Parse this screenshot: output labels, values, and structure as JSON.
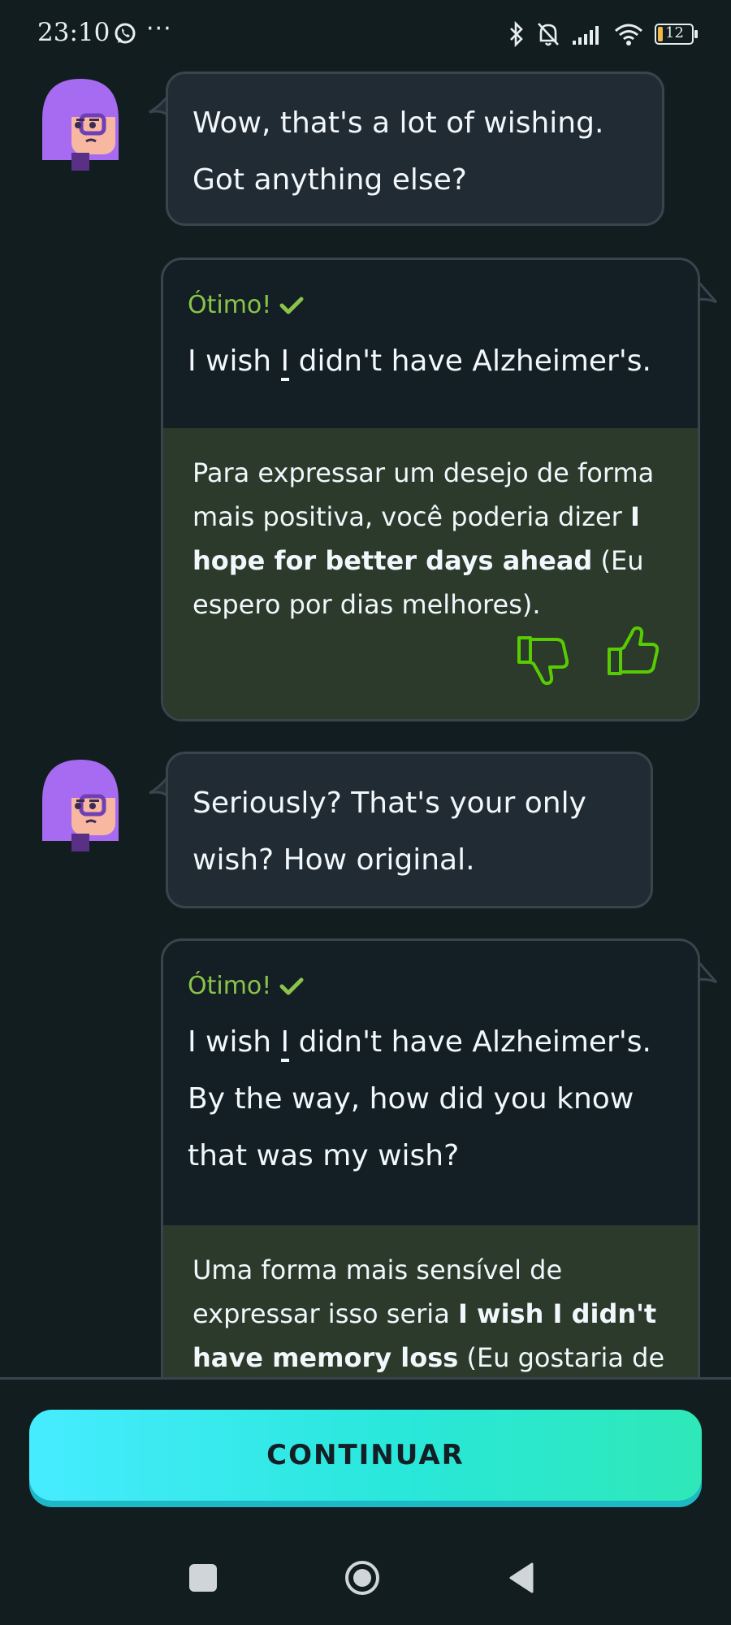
{
  "status_bar": {
    "time": "23:10",
    "more": "···",
    "battery": "12",
    "icons": [
      "whatsapp-icon",
      "bluetooth-icon",
      "bell-off-icon",
      "signal-icon",
      "wifi-icon",
      "battery-icon"
    ]
  },
  "messages": [
    {
      "speaker": "character",
      "text": "Wow, that's a lot of wishing. Got anything else?"
    },
    {
      "speaker": "user",
      "status": "Ótimo!",
      "text_before": "I wish ",
      "text_highlight": "I",
      "text_after": " didn't have Alzheimer's.",
      "tip_before": "Para expressar um desejo de forma mais positiva, você poderia dizer ",
      "tip_bold": "I hope for better days ahead",
      "tip_after": " (Eu espero por dias melhores)."
    },
    {
      "speaker": "character",
      "text": "Seriously? That's your only wish? How original."
    },
    {
      "speaker": "user",
      "status": "Ótimo!",
      "text_before": "I wish ",
      "text_highlight": "I",
      "text_after": " didn't have Alzheimer's. By the way, how did you know that was my wish?",
      "tip_before": "Uma forma mais sensível de expressar isso seria ",
      "tip_bold": "I wish I didn't have memory loss",
      "tip_after": " (Eu gostaria de"
    }
  ],
  "continue_label": "CONTINUAR",
  "colors": {
    "background": "#121d1f",
    "bubble": "#212b33",
    "tip": "#2b3a2b",
    "accent_green": "#8bc34a",
    "button_start": "#46ecff",
    "button_end": "#2ee8b8"
  }
}
